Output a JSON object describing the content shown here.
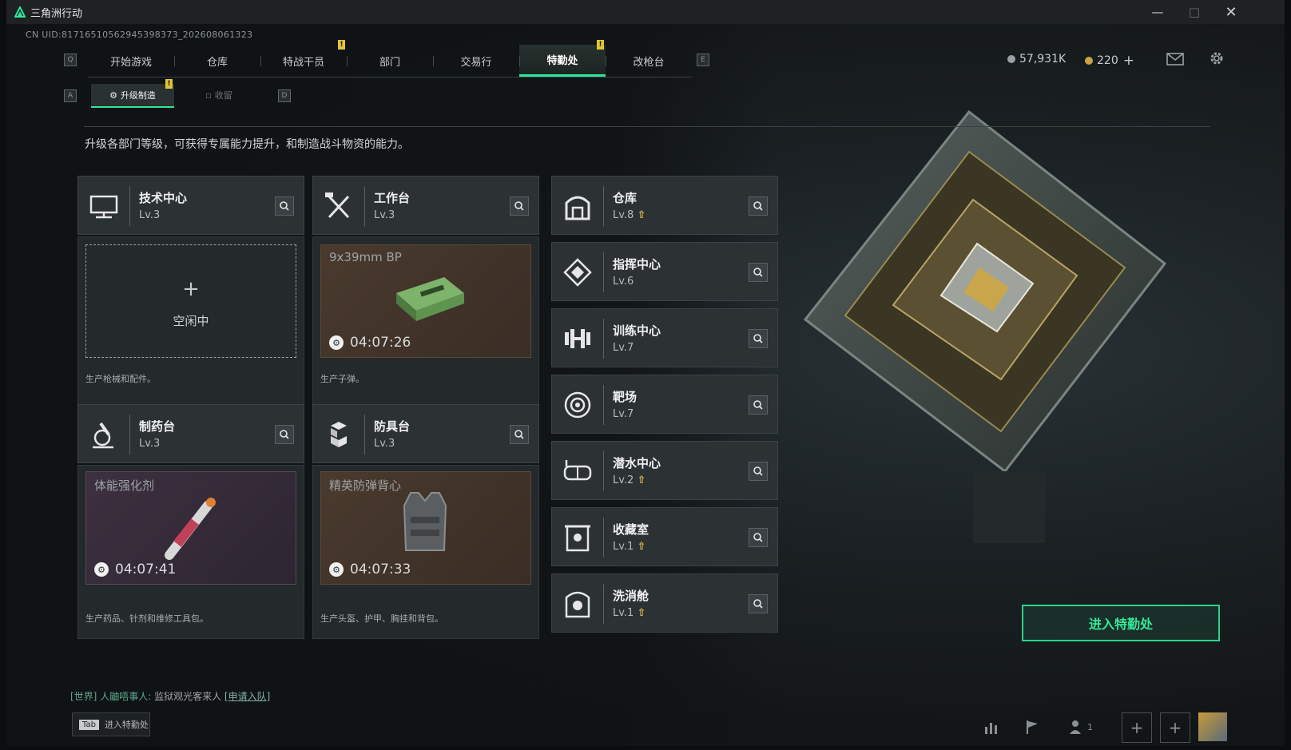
{
  "window": {
    "title": "三角洲行动"
  },
  "uid": "CN UID:8171651056294539837​3_202608061323",
  "nav": {
    "q_key": "Q",
    "e_key": "E",
    "tabs": [
      {
        "label": "开始游戏",
        "active": false,
        "badge": ""
      },
      {
        "label": "仓库",
        "active": false,
        "badge": ""
      },
      {
        "label": "特战干员",
        "active": false,
        "badge": "!"
      },
      {
        "label": "部门",
        "active": false,
        "badge": ""
      },
      {
        "label": "交易行",
        "active": false,
        "badge": ""
      },
      {
        "label": "特勤处",
        "active": true,
        "badge": "!"
      },
      {
        "label": "改枪台",
        "active": false,
        "badge": ""
      }
    ]
  },
  "subnav": {
    "a_key": "A",
    "d_key": "D",
    "tabs": [
      {
        "label": "升级制造",
        "active": true,
        "badge": "!"
      },
      {
        "label": "收留",
        "active": false
      }
    ]
  },
  "currency": {
    "coins": "57,931K",
    "tickets": "220"
  },
  "description": "升级各部门等级，可获得专属能力提升，和制造战斗物资的能力。",
  "stations": {
    "tech": {
      "name": "技术中心",
      "level": "Lv.3",
      "idle_label": "空闲中",
      "idle_plus": "+",
      "product_desc": "生产枪械和配件。"
    },
    "workbench": {
      "name": "工作台",
      "level": "Lv.3",
      "item": "9x39mm BP",
      "timer": "04:07:26",
      "product_desc": "生产子弹。"
    },
    "pharmacy": {
      "name": "制药台",
      "level": "Lv.3",
      "item": "体能强化剂",
      "timer": "04:07:41",
      "product_desc": "生产药品、针剂和维修工具包。"
    },
    "armor": {
      "name": "防具台",
      "level": "Lv.3",
      "item": "精英防弹背心",
      "timer": "04:07:33",
      "product_desc": "生产头盔、护甲、胸挂和背包。"
    }
  },
  "departments": [
    {
      "name": "仓库",
      "level": "Lv.8",
      "upgradable": true,
      "icon": "warehouse-icon"
    },
    {
      "name": "指挥中心",
      "level": "Lv.6",
      "upgradable": false,
      "icon": "command-center-icon"
    },
    {
      "name": "训练中心",
      "level": "Lv.7",
      "upgradable": false,
      "icon": "dumbbell-icon"
    },
    {
      "name": "靶场",
      "level": "Lv.7",
      "upgradable": false,
      "icon": "target-icon"
    },
    {
      "name": "潜水中心",
      "level": "Lv.2",
      "upgradable": true,
      "icon": "diving-mask-icon"
    },
    {
      "name": "收藏室",
      "level": "Lv.1",
      "upgradable": true,
      "icon": "collection-room-icon"
    },
    {
      "name": "洗消舱",
      "level": "Lv.1",
      "upgradable": true,
      "icon": "decontamination-icon"
    }
  ],
  "enter_button": "进入特勤处",
  "chat": {
    "channel": "[世界]",
    "user": "人鼬唔事人",
    "message": "监狱观光客来人",
    "link": "[申请入队]"
  },
  "tab_hint": {
    "key": "Tab",
    "label": "进入特勤处"
  },
  "friends_count": "1",
  "colors": {
    "accent": "#2ee59d",
    "badge": "#e3c33a",
    "upgrade": "#e5c24a"
  }
}
